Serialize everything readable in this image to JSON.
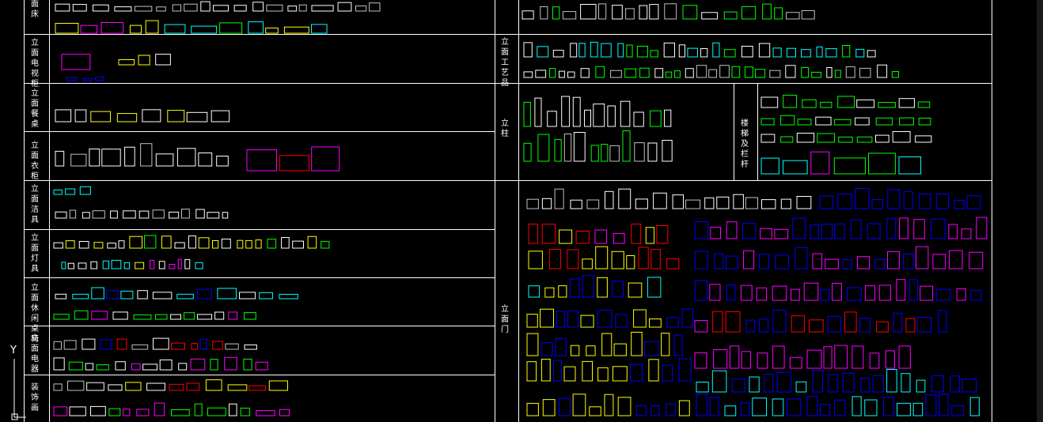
{
  "colors": {
    "background": "#000000",
    "grid_line": "#ffffff",
    "right_margin": "#1a1a1a",
    "symbols": [
      "#ffffff",
      "#c0c0c0",
      "#00ffff",
      "#ff00ff",
      "#ffff00",
      "#00ff00",
      "#ff0000",
      "#0000ff"
    ]
  },
  "left_categories": [
    {
      "key": "bed",
      "label": "面床"
    },
    {
      "key": "tv_cabinet",
      "label": "立面电视柜"
    },
    {
      "key": "dining_table",
      "label": "立面餐桌"
    },
    {
      "key": "wardrobe",
      "label": "立面衣柜"
    },
    {
      "key": "sanitary",
      "label": "立面洁具"
    },
    {
      "key": "lamps",
      "label": "立面灯具"
    },
    {
      "key": "leisure",
      "label": "立面休闲桌椅"
    },
    {
      "key": "appliances",
      "label": "立面电器"
    },
    {
      "key": "decor_painting",
      "label": "装饰画"
    }
  ],
  "right_categories": [
    {
      "key": "crafts",
      "label": "立面工艺品"
    },
    {
      "key": "columns",
      "label": "立柱"
    },
    {
      "key": "stairs",
      "label": "楼梯及栏杆"
    },
    {
      "key": "doors",
      "label": "立面门"
    }
  ],
  "ucs_icon": {
    "axis_label": "Y"
  }
}
